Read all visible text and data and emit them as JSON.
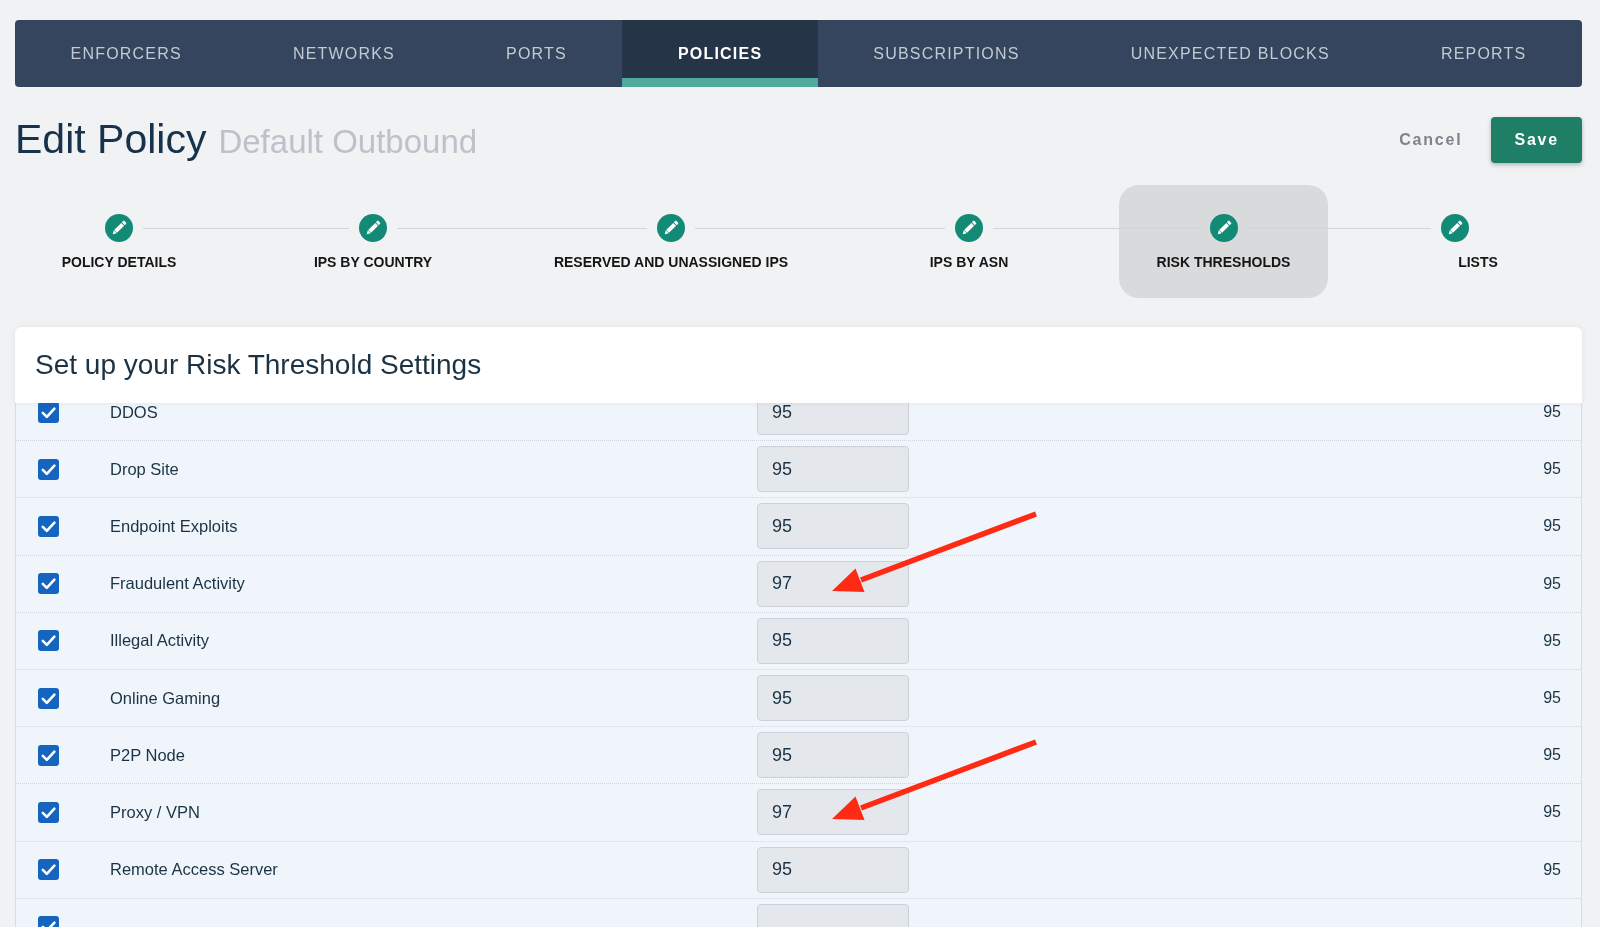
{
  "nav_tabs": [
    {
      "label": "ENFORCERS",
      "selected": false
    },
    {
      "label": "NETWORKS",
      "selected": false
    },
    {
      "label": "PORTS",
      "selected": false
    },
    {
      "label": "POLICIES",
      "selected": true
    },
    {
      "label": "SUBSCRIPTIONS",
      "selected": false
    },
    {
      "label": "UNEXPECTED BLOCKS",
      "selected": false
    },
    {
      "label": "REPORTS",
      "selected": false
    }
  ],
  "header": {
    "title": "Edit Policy",
    "subtitle": "Default Outbound",
    "buttons": [
      {
        "label": "Cancel",
        "kind": "plain"
      },
      {
        "label": "Save",
        "kind": "primary"
      }
    ]
  },
  "steps": [
    {
      "label": "POLICY DETAILS",
      "selected": false
    },
    {
      "label": "IPS BY COUNTRY",
      "selected": false
    },
    {
      "label": "RESERVED AND UNASSIGNED IPS",
      "selected": false
    },
    {
      "label": "IPS BY ASN",
      "selected": false
    },
    {
      "label": "RISK THRESHOLDS",
      "selected": true
    },
    {
      "label": "LISTS",
      "selected": false
    }
  ],
  "risk_thresholds": {
    "title": "Set up your Risk Threshold Settings",
    "rows": [
      {
        "checked": true,
        "name": "DDOS",
        "value": "95",
        "column_4": "95",
        "annotated": false
      },
      {
        "checked": true,
        "name": "Drop Site",
        "value": "95",
        "column_4": "95",
        "annotated": false
      },
      {
        "checked": true,
        "name": "Endpoint Exploits",
        "value": "95",
        "column_4": "95",
        "annotated": false
      },
      {
        "checked": true,
        "name": "Fraudulent Activity",
        "value": "97",
        "column_4": "95",
        "annotated": true
      },
      {
        "checked": true,
        "name": "Illegal Activity",
        "value": "95",
        "column_4": "95",
        "annotated": false
      },
      {
        "checked": true,
        "name": "Online Gaming",
        "value": "95",
        "column_4": "95",
        "annotated": false
      },
      {
        "checked": true,
        "name": "P2P Node",
        "value": "95",
        "column_4": "95",
        "annotated": false
      },
      {
        "checked": true,
        "name": "Proxy / VPN",
        "value": "97",
        "column_4": "95",
        "annotated": true
      },
      {
        "checked": true,
        "name": "Remote Access Server",
        "value": "95",
        "column_4": "95",
        "annotated": false
      },
      {
        "checked": true,
        "annotated": false
      }
    ]
  }
}
